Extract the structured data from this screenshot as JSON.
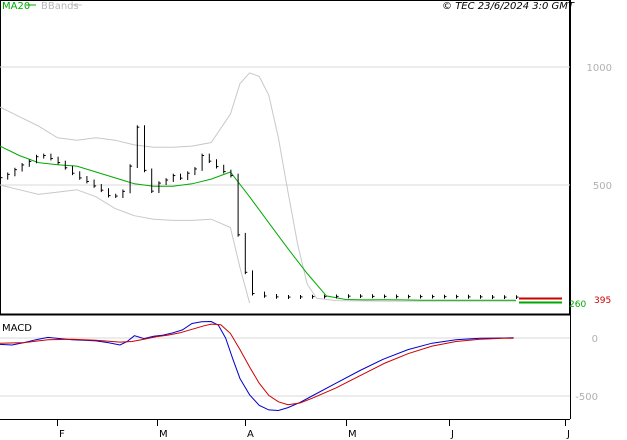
{
  "header": {
    "legend_ma": "MA20",
    "legend_bb": "BBands",
    "copyright": "© TEC 23/6/2024 3:0 GMT"
  },
  "panels": {
    "macd_label": "MACD"
  },
  "colors": {
    "price": "#000000",
    "ma": "#00aa00",
    "bbands": "#c8c8c8",
    "macd": "#0000cc",
    "signal": "#cc0000",
    "grid": "#d8d8d8",
    "axis_text": "#b0b0b0",
    "last_price": "#cc0000",
    "last_ma": "#00aa00"
  },
  "chart_data": [
    {
      "type": "line",
      "title": "",
      "x_ticks": [
        "F",
        "M",
        "A",
        "M",
        "J",
        "J"
      ],
      "y_ticks": [
        {
          "value": 1000,
          "label": "1000"
        },
        {
          "value": 500,
          "label": "500"
        }
      ],
      "ylim": [
        0,
        1300
      ],
      "last_labels": [
        {
          "series": "MA20",
          "value": 260,
          "label": "260"
        },
        {
          "series": "price",
          "value": 395,
          "label": "395"
        }
      ],
      "series": [
        {
          "name": "price",
          "points": [
            [
              0,
              531
            ],
            [
              3,
              545
            ],
            [
              6,
              565
            ],
            [
              9,
              585
            ],
            [
              12,
              600
            ],
            [
              15,
              620
            ],
            [
              18,
              625
            ],
            [
              21,
              612
            ],
            [
              24,
              595
            ],
            [
              27,
              573
            ],
            [
              30,
              550
            ],
            [
              33,
              530
            ],
            [
              36,
              515
            ],
            [
              39,
              496
            ],
            [
              42,
              478
            ],
            [
              45,
              455
            ],
            [
              48,
              453
            ],
            [
              51,
              473
            ],
            [
              54,
              580
            ],
            [
              57,
              745
            ],
            [
              60,
              562
            ],
            [
              63,
              474
            ],
            [
              66,
              508
            ],
            [
              69,
              521
            ],
            [
              72,
              540
            ],
            [
              75,
              529
            ],
            [
              78,
              550
            ],
            [
              81,
              568
            ],
            [
              84,
              625
            ],
            [
              87,
              601
            ],
            [
              90,
              578
            ],
            [
              93,
              557
            ],
            [
              96,
              540
            ],
            [
              99,
              289
            ],
            [
              102,
              130
            ],
            [
              105,
              40
            ],
            [
              110,
              30
            ],
            [
              115,
              26
            ],
            [
              120,
              25
            ],
            [
              125,
              26
            ],
            [
              130,
              27
            ],
            [
              135,
              27
            ],
            [
              140,
              28
            ],
            [
              145,
              29
            ],
            [
              150,
              29
            ],
            [
              155,
              28
            ],
            [
              160,
              28
            ],
            [
              165,
              27
            ],
            [
              170,
              27
            ],
            [
              175,
              27
            ],
            [
              180,
              27
            ],
            [
              185,
              27
            ],
            [
              190,
              27
            ],
            [
              195,
              26
            ],
            [
              200,
              26
            ],
            [
              205,
              25
            ],
            [
              210,
              25
            ],
            [
              215,
              25
            ]
          ]
        },
        {
          "name": "MA20",
          "points": [
            [
              0,
              665
            ],
            [
              8,
              625
            ],
            [
              16,
              595
            ],
            [
              24,
              586
            ],
            [
              32,
              580
            ],
            [
              40,
              555
            ],
            [
              48,
              530
            ],
            [
              56,
              505
            ],
            [
              64,
              495
            ],
            [
              72,
              495
            ],
            [
              80,
              505
            ],
            [
              88,
              525
            ],
            [
              96,
              555
            ],
            [
              104,
              450
            ],
            [
              112,
              340
            ],
            [
              120,
              230
            ],
            [
              128,
              125
            ],
            [
              136,
              30
            ],
            [
              144,
              15
            ],
            [
              152,
              13
            ],
            [
              160,
              14
            ],
            [
              168,
              13
            ],
            [
              176,
              12
            ],
            [
              184,
              12
            ],
            [
              192,
              12
            ],
            [
              200,
              12
            ],
            [
              208,
              12
            ],
            [
              215,
              12
            ]
          ]
        },
        {
          "name": "BBands upper",
          "points": [
            [
              0,
              830
            ],
            [
              8,
              790
            ],
            [
              16,
              750
            ],
            [
              24,
              700
            ],
            [
              32,
              690
            ],
            [
              40,
              700
            ],
            [
              48,
              690
            ],
            [
              56,
              670
            ],
            [
              64,
              660
            ],
            [
              72,
              660
            ],
            [
              80,
              665
            ],
            [
              88,
              680
            ],
            [
              96,
              800
            ],
            [
              100,
              930
            ],
            [
              104,
              975
            ],
            [
              108,
              960
            ],
            [
              112,
              880
            ],
            [
              116,
              700
            ],
            [
              120,
              470
            ],
            [
              124,
              250
            ],
            [
              128,
              80
            ],
            [
              132,
              20
            ],
            [
              140,
              10
            ],
            [
              160,
              8
            ],
            [
              180,
              8
            ],
            [
              200,
              8
            ],
            [
              215,
              8
            ]
          ]
        },
        {
          "name": "BBands lower",
          "points": [
            [
              0,
              500
            ],
            [
              8,
              480
            ],
            [
              16,
              460
            ],
            [
              24,
              470
            ],
            [
              32,
              480
            ],
            [
              40,
              450
            ],
            [
              48,
              400
            ],
            [
              56,
              370
            ],
            [
              64,
              355
            ],
            [
              72,
              350
            ],
            [
              80,
              350
            ],
            [
              88,
              355
            ],
            [
              96,
              320
            ],
            [
              100,
              150
            ],
            [
              104,
              0
            ]
          ]
        },
        {
          "name": "MACD",
          "points": [
            [
              0,
              -55
            ],
            [
              5,
              -60
            ],
            [
              10,
              -40
            ],
            [
              15,
              -15
            ],
            [
              20,
              5
            ],
            [
              25,
              -5
            ],
            [
              30,
              -15
            ],
            [
              35,
              -20
            ],
            [
              40,
              -25
            ],
            [
              45,
              -40
            ],
            [
              50,
              -60
            ],
            [
              53,
              -30
            ],
            [
              56,
              20
            ],
            [
              60,
              -5
            ],
            [
              64,
              15
            ],
            [
              68,
              25
            ],
            [
              72,
              45
            ],
            [
              76,
              70
            ],
            [
              80,
              125
            ],
            [
              84,
              140
            ],
            [
              88,
              142
            ],
            [
              91,
              110
            ],
            [
              94,
              0
            ],
            [
              97,
              -180
            ],
            [
              100,
              -350
            ],
            [
              104,
              -490
            ],
            [
              108,
              -580
            ],
            [
              112,
              -620
            ],
            [
              116,
              -625
            ],
            [
              120,
              -600
            ],
            [
              125,
              -555
            ],
            [
              130,
              -500
            ],
            [
              140,
              -390
            ],
            [
              150,
              -280
            ],
            [
              160,
              -180
            ],
            [
              170,
              -100
            ],
            [
              180,
              -45
            ],
            [
              190,
              -15
            ],
            [
              200,
              -2
            ],
            [
              210,
              0
            ],
            [
              214,
              2
            ]
          ]
        },
        {
          "name": "Signal",
          "points": [
            [
              0,
              -45
            ],
            [
              10,
              -40
            ],
            [
              20,
              -15
            ],
            [
              30,
              -10
            ],
            [
              40,
              -20
            ],
            [
              50,
              -35
            ],
            [
              55,
              -30
            ],
            [
              60,
              -10
            ],
            [
              65,
              10
            ],
            [
              70,
              25
            ],
            [
              75,
              45
            ],
            [
              80,
              75
            ],
            [
              85,
              105
            ],
            [
              88,
              120
            ],
            [
              92,
              115
            ],
            [
              96,
              40
            ],
            [
              100,
              -100
            ],
            [
              104,
              -250
            ],
            [
              108,
              -390
            ],
            [
              112,
              -495
            ],
            [
              116,
              -550
            ],
            [
              120,
              -575
            ],
            [
              125,
              -560
            ],
            [
              130,
              -520
            ],
            [
              140,
              -430
            ],
            [
              150,
              -325
            ],
            [
              160,
              -220
            ],
            [
              170,
              -135
            ],
            [
              180,
              -70
            ],
            [
              190,
              -30
            ],
            [
              200,
              -10
            ],
            [
              210,
              -3
            ],
            [
              214,
              -2
            ]
          ]
        }
      ]
    },
    {
      "type": "line",
      "title": "",
      "y_ticks": [
        {
          "value": 0,
          "label": "0"
        },
        {
          "value": -500,
          "label": "-500"
        }
      ]
    }
  ]
}
